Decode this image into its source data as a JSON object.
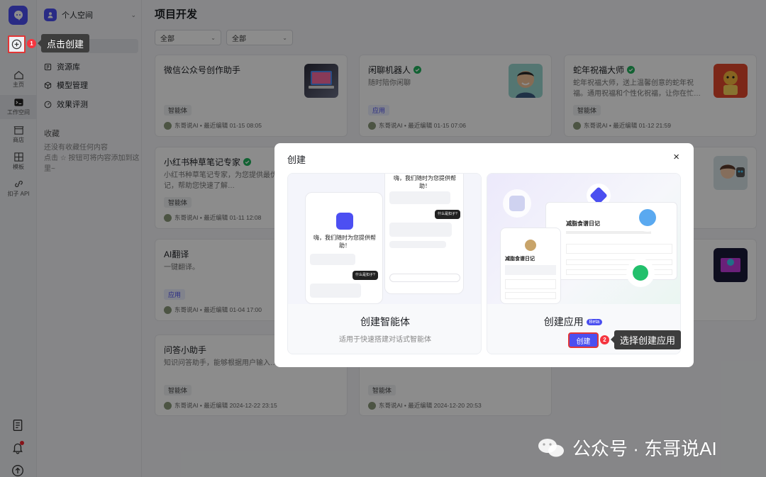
{
  "rail": {
    "items": [
      {
        "label": "主页"
      },
      {
        "label": "工作空间"
      },
      {
        "label": "商店"
      },
      {
        "label": "模板"
      },
      {
        "label": "扣子 API"
      }
    ]
  },
  "sidebar": {
    "space_name": "个人空间",
    "menu": [
      {
        "label": "资源库"
      },
      {
        "label": "模型管理"
      },
      {
        "label": "效果评测"
      }
    ],
    "favorites_title": "收藏",
    "favorites_empty_line1": "还没有收藏任何内容",
    "favorites_empty_line2": "点击 ☆ 按钮可将内容添加到这里~"
  },
  "tooltips": {
    "step1_num": "1",
    "step1_text": "点击创建",
    "step2_num": "2",
    "step2_text": "选择创建应用"
  },
  "main": {
    "title": "项目开发",
    "filters": [
      "全部",
      "全部"
    ],
    "cards": [
      {
        "title": "微信公众号创作助手",
        "desc": "",
        "tag": "智能体",
        "tag_type": "agent",
        "author": "东哥说AI",
        "edited": "最近编辑 01-15 08:05",
        "verified": false
      },
      {
        "title": "闲聊机器人",
        "desc": "随时陪你闲聊",
        "tag": "应用",
        "tag_type": "app",
        "author": "东哥说AI",
        "edited": "最近编辑 01-15 07:06",
        "verified": true
      },
      {
        "title": "蛇年祝福大师",
        "desc": "蛇年祝福大师，送上温馨创意的蛇年祝福。通用祝福和个性化祝福，让你在忙…",
        "tag": "智能体",
        "tag_type": "agent",
        "author": "东哥说AI",
        "edited": "最近编辑 01-12 21:59",
        "verified": true
      },
      {
        "title": "小红书种草笔记专家",
        "desc": "小红书种草笔记专家，为您提供最优质的商品种草笔记，帮助您快速了解…",
        "tag": "智能体",
        "tag_type": "agent",
        "author": "东哥说AI",
        "edited": "最近编辑 01-11 12:08",
        "verified": true
      },
      {
        "title": "AI翻译",
        "desc": "一键翻译。",
        "tag": "应用",
        "tag_type": "app",
        "author": "东哥说AI",
        "edited": "最近编辑 01-04 17:00",
        "verified": false
      },
      {
        "title": "问答小助手",
        "desc": "知识问答助手，能够根据用户输入…",
        "tag": "智能体",
        "tag_type": "agent",
        "author": "东哥说AI",
        "edited": "最近编辑 2024-12-22 23:15",
        "verified": false
      },
      {
        "title": "",
        "desc": "",
        "tag": "智能体",
        "tag_type": "agent",
        "author": "东哥说AI",
        "edited": "最近编辑 2024-12-20 20:53",
        "verified": false
      }
    ]
  },
  "modal": {
    "title": "创建",
    "close": "×",
    "agent_option": {
      "title": "创建智能体",
      "desc": "适用于快速搭建对话式智能体",
      "illu_greeting": "嗨，我们随时为您提供帮助！",
      "illu_question": "什么是扣子?"
    },
    "app_option": {
      "title": "创建应用",
      "beta": "Beta",
      "button": "创建",
      "illu_heading": "减脂食谱日记"
    }
  },
  "watermark": "公众号 · 东哥说AI",
  "colors": {
    "accent": "#4b4ff0",
    "highlight": "#e23636",
    "verified": "#22b35e"
  }
}
